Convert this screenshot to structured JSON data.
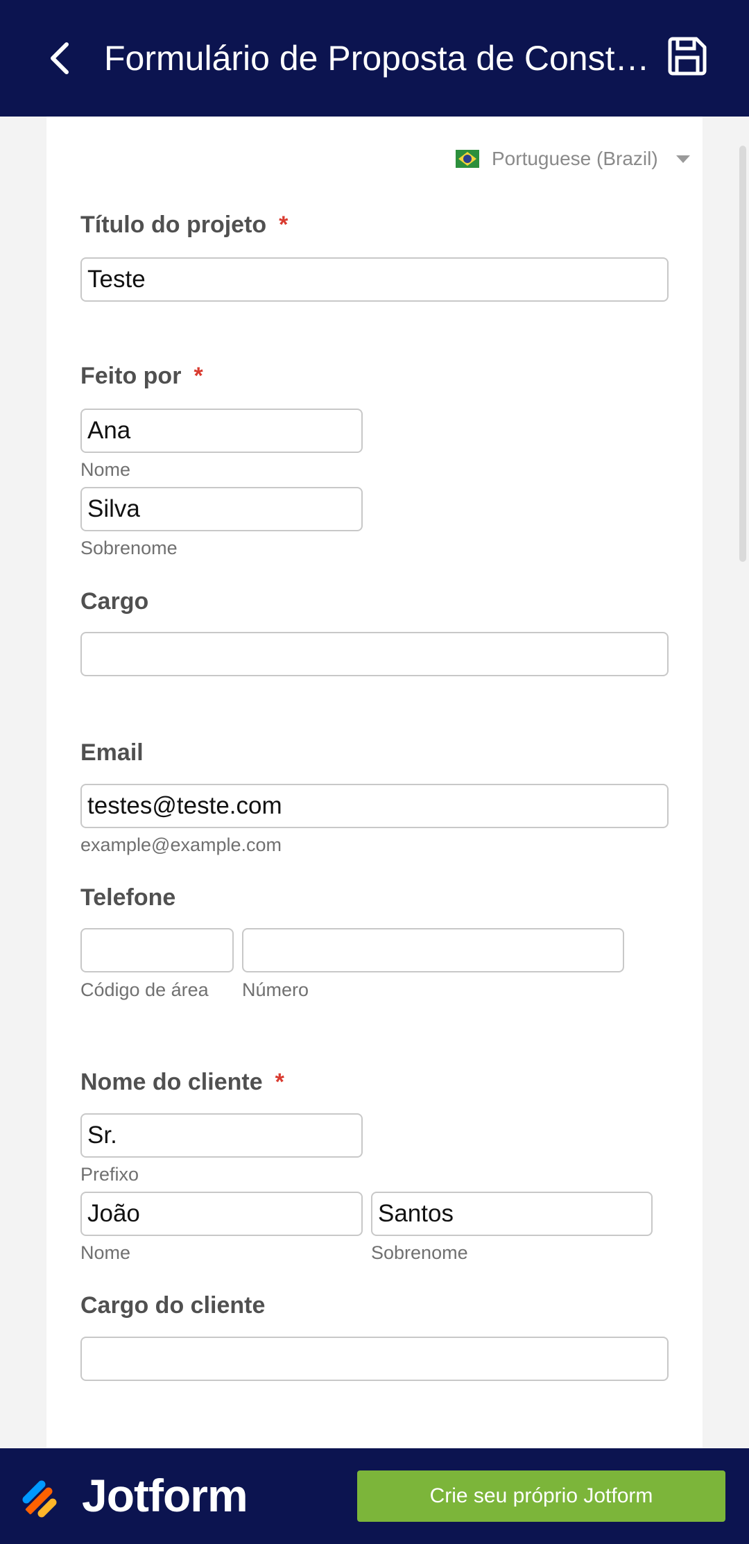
{
  "header": {
    "title": "Formulário de Proposta de Constr...",
    "back_icon": "chevron-left-icon",
    "save_icon": "floppy-disk-icon"
  },
  "language": {
    "label": "Portuguese (Brazil)",
    "flag_icon": "brazil-flag-icon"
  },
  "form": {
    "project_title": {
      "label": "Título do projeto",
      "required_mark": "*",
      "value": "Teste"
    },
    "made_by": {
      "label": "Feito por",
      "required_mark": "*",
      "first_value": "Ana",
      "first_sub": "Nome",
      "last_value": "Silva",
      "last_sub": "Sobrenome"
    },
    "role": {
      "label": "Cargo",
      "value": ""
    },
    "email": {
      "label": "Email",
      "value": "testes@teste.com",
      "sub": "example@example.com"
    },
    "phone": {
      "label": "Telefone",
      "area_value": "",
      "area_sub": "Código de área",
      "number_value": "",
      "number_sub": "Número"
    },
    "client_name": {
      "label": "Nome do cliente",
      "required_mark": "*",
      "prefix_value": "Sr.",
      "prefix_sub": "Prefixo",
      "first_value": "João",
      "first_sub": "Nome",
      "last_value": "Santos",
      "last_sub": "Sobrenome"
    },
    "client_role": {
      "label": "Cargo do cliente",
      "value": ""
    }
  },
  "footer": {
    "logo_text": "Jotform",
    "cta_label": "Crie seu próprio Jotform"
  },
  "colors": {
    "header_bg": "#0c1450",
    "cta_bg": "#7cb53a",
    "required": "#d93b30"
  }
}
